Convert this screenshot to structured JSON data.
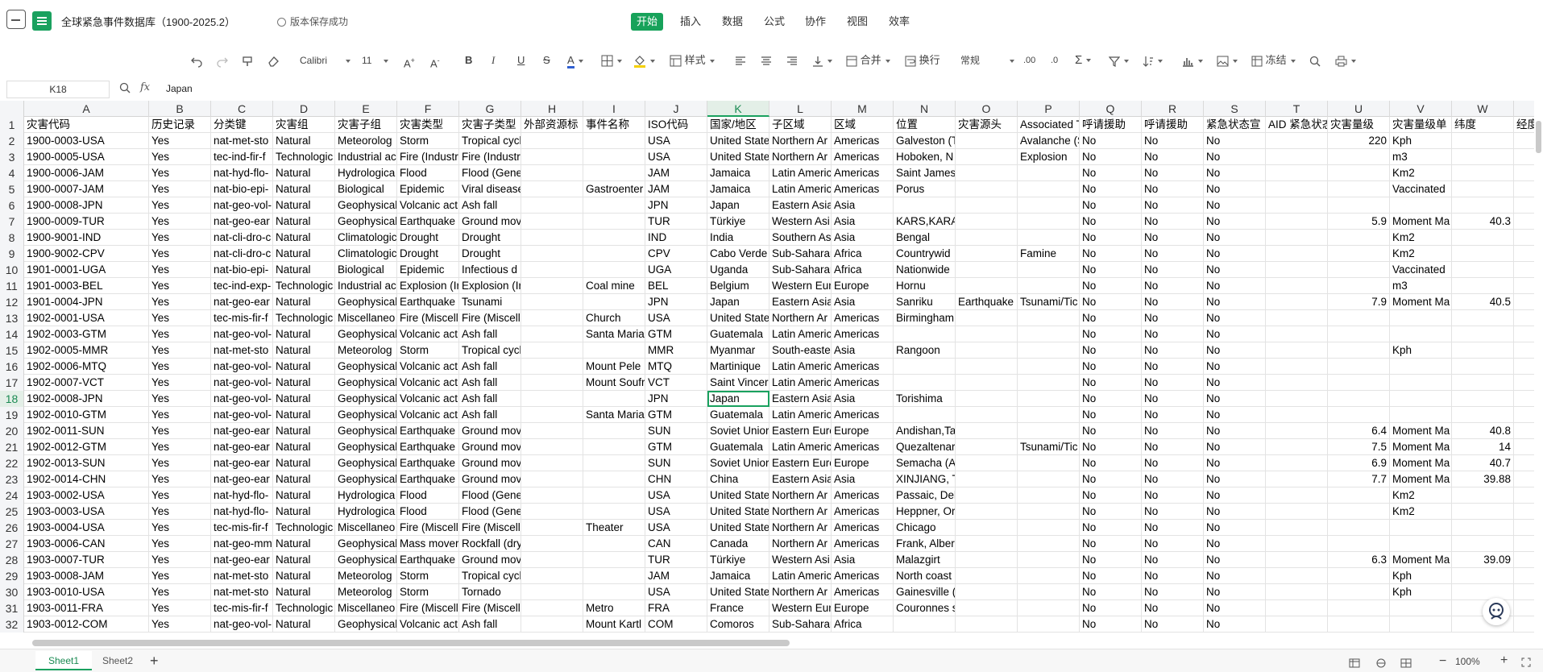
{
  "titlebar": {
    "doc_title": "全球紧急事件数据库（1900-2025.2）",
    "save_status": "版本保存成功",
    "menu_tabs": [
      "开始",
      "插入",
      "数据",
      "公式",
      "协作",
      "视图",
      "效率"
    ]
  },
  "toolbar": {
    "font_name": "Calibri",
    "font_size": "11",
    "style_label": "样式",
    "merge_label": "合并",
    "wrap_label": "换行",
    "format_label": "常规",
    "freeze_label": "冻结"
  },
  "formula_bar": {
    "cell_ref": "K18",
    "fx": "fx",
    "content": "Japan"
  },
  "grid": {
    "columns": [
      "A",
      "B",
      "C",
      "D",
      "E",
      "F",
      "G",
      "H",
      "I",
      "J",
      "K",
      "L",
      "M",
      "N",
      "O",
      "P",
      "Q",
      "R",
      "S",
      "T",
      "U",
      "V",
      "W",
      ""
    ],
    "header_row": [
      "灾害代码",
      "历史记录",
      "分类键",
      "灾害组",
      "灾害子组",
      "灾害类型",
      "灾害子类型",
      "外部资源标",
      "事件名称",
      "ISO代码",
      "国家/地区",
      "子区域",
      "区域",
      "位置",
      "灾害源头",
      "Associated T",
      "呼请援助",
      "呼请援助",
      "紧急状态宣",
      "AID 紧急状态",
      "灾害量级",
      "灾害量级单",
      "纬度",
      "经度"
    ],
    "rows": [
      {
        "n": "2",
        "cells": [
          "1900-0003-USA",
          "Yes",
          "nat-met-sto",
          "Natural",
          "Meteorolog",
          "Storm",
          "Tropical cycl",
          "",
          "",
          "USA",
          "United State",
          "Northern Ar",
          "Americas",
          "Galveston (T",
          "",
          "Avalanche (S",
          "No",
          "No",
          "No",
          "",
          "220",
          "Kph",
          "",
          ""
        ]
      },
      {
        "n": "3",
        "cells": [
          "1900-0005-USA",
          "Yes",
          "tec-ind-fir-f",
          "Technologic",
          "Industrial ac",
          "Fire (Industr",
          "Fire (Industr",
          "",
          "",
          "USA",
          "United State",
          "Northern Ar",
          "Americas",
          "Hoboken, N",
          "",
          "Explosion",
          "No",
          "No",
          "No",
          "",
          "",
          "m3",
          "",
          ""
        ]
      },
      {
        "n": "4",
        "cells": [
          "1900-0006-JAM",
          "Yes",
          "nat-hyd-flo-",
          "Natural",
          "Hydrologica",
          "Flood",
          "Flood (Gene",
          "",
          "",
          "JAM",
          "Jamaica",
          "Latin Americ",
          "Americas",
          "Saint James",
          "",
          "",
          "No",
          "No",
          "No",
          "",
          "",
          "Km2",
          "",
          ""
        ]
      },
      {
        "n": "5",
        "cells": [
          "1900-0007-JAM",
          "Yes",
          "nat-bio-epi-",
          "Natural",
          "Biological",
          "Epidemic",
          "Viral disease",
          "",
          "Gastroenter",
          "JAM",
          "Jamaica",
          "Latin Americ",
          "Americas",
          "Porus",
          "",
          "",
          "No",
          "No",
          "No",
          "",
          "",
          "Vaccinated",
          "",
          ""
        ]
      },
      {
        "n": "6",
        "cells": [
          "1900-0008-JPN",
          "Yes",
          "nat-geo-vol-",
          "Natural",
          "Geophysical",
          "Volcanic act",
          "Ash fall",
          "",
          "",
          "JPN",
          "Japan",
          "Eastern Asia",
          "Asia",
          "",
          "",
          "",
          "No",
          "No",
          "No",
          "",
          "",
          "",
          "",
          ""
        ]
      },
      {
        "n": "7",
        "cells": [
          "1900-0009-TUR",
          "Yes",
          "nat-geo-ear",
          "Natural",
          "Geophysical",
          "Earthquake",
          "Ground mov",
          "",
          "",
          "TUR",
          "Türkiye",
          "Western Asi",
          "Asia",
          "KARS,KARAK",
          "",
          "",
          "No",
          "No",
          "No",
          "",
          "5.9",
          "Moment Ma",
          "40.3",
          ""
        ]
      },
      {
        "n": "8",
        "cells": [
          "1900-9001-IND",
          "Yes",
          "nat-cli-dro-c",
          "Natural",
          "Climatologic",
          "Drought",
          "Drought",
          "",
          "",
          "IND",
          "India",
          "Southern As",
          "Asia",
          "Bengal",
          "",
          "",
          "No",
          "No",
          "No",
          "",
          "",
          "Km2",
          "",
          ""
        ]
      },
      {
        "n": "9",
        "cells": [
          "1900-9002-CPV",
          "Yes",
          "nat-cli-dro-c",
          "Natural",
          "Climatologic",
          "Drought",
          "Drought",
          "",
          "",
          "CPV",
          "Cabo Verde",
          "Sub-Saharar",
          "Africa",
          "Countrywid",
          "",
          "Famine",
          "No",
          "No",
          "No",
          "",
          "",
          "Km2",
          "",
          ""
        ]
      },
      {
        "n": "10",
        "cells": [
          "1901-0001-UGA",
          "Yes",
          "nat-bio-epi-",
          "Natural",
          "Biological",
          "Epidemic",
          "Infectious d",
          "",
          "",
          "UGA",
          "Uganda",
          "Sub-Saharar",
          "Africa",
          "Nationwide",
          "",
          "",
          "No",
          "No",
          "No",
          "",
          "",
          "Vaccinated",
          "",
          ""
        ]
      },
      {
        "n": "11",
        "cells": [
          "1901-0003-BEL",
          "Yes",
          "tec-ind-exp-",
          "Technologic",
          "Industrial ac",
          "Explosion (Ir",
          "Explosion (Ir",
          "",
          "Coal mine",
          "BEL",
          "Belgium",
          "Western Eur",
          "Europe",
          "Hornu",
          "",
          "",
          "No",
          "No",
          "No",
          "",
          "",
          "m3",
          "",
          ""
        ]
      },
      {
        "n": "12",
        "cells": [
          "1901-0004-JPN",
          "Yes",
          "nat-geo-ear",
          "Natural",
          "Geophysical",
          "Earthquake",
          "Tsunami",
          "",
          "",
          "JPN",
          "Japan",
          "Eastern Asia",
          "Asia",
          "Sanriku",
          "Earthquake",
          "Tsunami/Tic",
          "No",
          "No",
          "No",
          "",
          "7.9",
          "Moment Ma",
          "40.5",
          ""
        ]
      },
      {
        "n": "13",
        "cells": [
          "1902-0001-USA",
          "Yes",
          "tec-mis-fir-f",
          "Technologic",
          "Miscellaneo",
          "Fire (Miscell",
          "Fire (Miscell",
          "",
          "Church",
          "USA",
          "United State",
          "Northern Ar",
          "Americas",
          "Birmingham",
          "",
          "",
          "No",
          "No",
          "No",
          "",
          "",
          "",
          "",
          ""
        ]
      },
      {
        "n": "14",
        "cells": [
          "1902-0003-GTM",
          "Yes",
          "nat-geo-vol-",
          "Natural",
          "Geophysical",
          "Volcanic act",
          "Ash fall",
          "",
          "Santa Maria",
          "GTM",
          "Guatemala",
          "Latin Americ",
          "Americas",
          "",
          "",
          "",
          "No",
          "No",
          "No",
          "",
          "",
          "",
          "",
          ""
        ]
      },
      {
        "n": "15",
        "cells": [
          "1902-0005-MMR",
          "Yes",
          "nat-met-sto",
          "Natural",
          "Meteorolog",
          "Storm",
          "Tropical cycl",
          "",
          "",
          "MMR",
          "Myanmar",
          "South-easte",
          "Asia",
          "Rangoon",
          "",
          "",
          "No",
          "No",
          "No",
          "",
          "",
          "Kph",
          "",
          ""
        ]
      },
      {
        "n": "16",
        "cells": [
          "1902-0006-MTQ",
          "Yes",
          "nat-geo-vol-",
          "Natural",
          "Geophysical",
          "Volcanic act",
          "Ash fall",
          "",
          "Mount Pele",
          "MTQ",
          "Martinique",
          "Latin Americ",
          "Americas",
          "",
          "",
          "",
          "No",
          "No",
          "No",
          "",
          "",
          "",
          "",
          ""
        ]
      },
      {
        "n": "17",
        "cells": [
          "1902-0007-VCT",
          "Yes",
          "nat-geo-vol-",
          "Natural",
          "Geophysical",
          "Volcanic act",
          "Ash fall",
          "",
          "Mount Soufr",
          "VCT",
          "Saint Vincer",
          "Latin Americ",
          "Americas",
          "",
          "",
          "",
          "No",
          "No",
          "No",
          "",
          "",
          "",
          "",
          ""
        ]
      },
      {
        "n": "18",
        "cells": [
          "1902-0008-JPN",
          "Yes",
          "nat-geo-vol-",
          "Natural",
          "Geophysical",
          "Volcanic act",
          "Ash fall",
          "",
          "",
          "JPN",
          "Japan",
          "Eastern Asia",
          "Asia",
          "Torishima",
          "",
          "",
          "No",
          "No",
          "No",
          "",
          "",
          "",
          "",
          ""
        ]
      },
      {
        "n": "19",
        "cells": [
          "1902-0010-GTM",
          "Yes",
          "nat-geo-vol-",
          "Natural",
          "Geophysical",
          "Volcanic act",
          "Ash fall",
          "",
          "Santa Maria",
          "GTM",
          "Guatemala",
          "Latin Americ",
          "Americas",
          "",
          "",
          "",
          "No",
          "No",
          "No",
          "",
          "",
          "",
          "",
          ""
        ]
      },
      {
        "n": "20",
        "cells": [
          "1902-0011-SUN",
          "Yes",
          "nat-geo-ear",
          "Natural",
          "Geophysical",
          "Earthquake",
          "Ground mov",
          "",
          "",
          "SUN",
          "Soviet Unior",
          "Eastern Eurc",
          "Europe",
          "Andishan,Ta",
          "",
          "",
          "No",
          "No",
          "No",
          "",
          "6.4",
          "Moment Ma",
          "40.8",
          ""
        ]
      },
      {
        "n": "21",
        "cells": [
          "1902-0012-GTM",
          "Yes",
          "nat-geo-ear",
          "Natural",
          "Geophysical",
          "Earthquake",
          "Ground mov",
          "",
          "",
          "GTM",
          "Guatemala",
          "Latin Americ",
          "Americas",
          "Quezaltenar",
          "",
          "Tsunami/Tic",
          "No",
          "No",
          "No",
          "",
          "7.5",
          "Moment Ma",
          "14",
          ""
        ]
      },
      {
        "n": "22",
        "cells": [
          "1902-0013-SUN",
          "Yes",
          "nat-geo-ear",
          "Natural",
          "Geophysical",
          "Earthquake",
          "Ground mov",
          "",
          "",
          "SUN",
          "Soviet Unior",
          "Eastern Eurc",
          "Europe",
          "Semacha (Az",
          "",
          "",
          "No",
          "No",
          "No",
          "",
          "6.9",
          "Moment Ma",
          "40.7",
          ""
        ]
      },
      {
        "n": "23",
        "cells": [
          "1902-0014-CHN",
          "Yes",
          "nat-geo-ear",
          "Natural",
          "Geophysical",
          "Earthquake",
          "Ground mov",
          "",
          "",
          "CHN",
          "China",
          "Eastern Asia",
          "Asia",
          "XINJIANG, T",
          "",
          "",
          "No",
          "No",
          "No",
          "",
          "7.7",
          "Moment Ma",
          "39.88",
          ""
        ]
      },
      {
        "n": "24",
        "cells": [
          "1903-0002-USA",
          "Yes",
          "nat-hyd-flo-",
          "Natural",
          "Hydrologica",
          "Flood",
          "Flood (Gene",
          "",
          "",
          "USA",
          "United State",
          "Northern Ar",
          "Americas",
          "Passaic, Dela",
          "",
          "",
          "No",
          "No",
          "No",
          "",
          "",
          "Km2",
          "",
          ""
        ]
      },
      {
        "n": "25",
        "cells": [
          "1903-0003-USA",
          "Yes",
          "nat-hyd-flo-",
          "Natural",
          "Hydrologica",
          "Flood",
          "Flood (Gene",
          "",
          "",
          "USA",
          "United State",
          "Northern Ar",
          "Americas",
          "Heppner, Or",
          "",
          "",
          "No",
          "No",
          "No",
          "",
          "",
          "Km2",
          "",
          ""
        ]
      },
      {
        "n": "26",
        "cells": [
          "1903-0004-USA",
          "Yes",
          "tec-mis-fir-f",
          "Technologic",
          "Miscellaneo",
          "Fire (Miscell",
          "Fire (Miscell",
          "",
          "Theater",
          "USA",
          "United State",
          "Northern Ar",
          "Americas",
          "Chicago",
          "",
          "",
          "No",
          "No",
          "No",
          "",
          "",
          "",
          "",
          ""
        ]
      },
      {
        "n": "27",
        "cells": [
          "1903-0006-CAN",
          "Yes",
          "nat-geo-mm",
          "Natural",
          "Geophysical",
          "Mass mover",
          "Rockfall (dry",
          "",
          "",
          "CAN",
          "Canada",
          "Northern Ar",
          "Americas",
          "Frank, Alber",
          "",
          "",
          "No",
          "No",
          "No",
          "",
          "",
          "",
          "",
          ""
        ]
      },
      {
        "n": "28",
        "cells": [
          "1903-0007-TUR",
          "Yes",
          "nat-geo-ear",
          "Natural",
          "Geophysical",
          "Earthquake",
          "Ground mov",
          "",
          "",
          "TUR",
          "Türkiye",
          "Western Asi",
          "Asia",
          "Malazgirt",
          "",
          "",
          "No",
          "No",
          "No",
          "",
          "6.3",
          "Moment Ma",
          "39.09",
          ""
        ]
      },
      {
        "n": "29",
        "cells": [
          "1903-0008-JAM",
          "Yes",
          "nat-met-sto",
          "Natural",
          "Meteorolog",
          "Storm",
          "Tropical cycl",
          "",
          "",
          "JAM",
          "Jamaica",
          "Latin Americ",
          "Americas",
          "North coast",
          "",
          "",
          "No",
          "No",
          "No",
          "",
          "",
          "Kph",
          "",
          ""
        ]
      },
      {
        "n": "30",
        "cells": [
          "1903-0010-USA",
          "Yes",
          "nat-met-sto",
          "Natural",
          "Meteorolog",
          "Storm",
          "Tornado",
          "",
          "",
          "USA",
          "United State",
          "Northern Ar",
          "Americas",
          "Gainesville (",
          "",
          "",
          "No",
          "No",
          "No",
          "",
          "",
          "Kph",
          "",
          ""
        ]
      },
      {
        "n": "31",
        "cells": [
          "1903-0011-FRA",
          "Yes",
          "tec-mis-fir-f",
          "Technologic",
          "Miscellaneo",
          "Fire (Miscell",
          "Fire (Miscell",
          "",
          "Metro",
          "FRA",
          "France",
          "Western Eur",
          "Europe",
          "Couronnes s",
          "",
          "",
          "No",
          "No",
          "No",
          "",
          "",
          "",
          "",
          ""
        ]
      },
      {
        "n": "32",
        "cells": [
          "1903-0012-COM",
          "Yes",
          "nat-geo-vol-",
          "Natural",
          "Geophysical",
          "Volcanic act",
          "Ash fall",
          "",
          "Mount Kartl",
          "COM",
          "Comoros",
          "Sub-Saharar",
          "Africa",
          "",
          "",
          "",
          "No",
          "No",
          "No",
          "",
          "",
          "",
          "",
          ""
        ]
      }
    ]
  },
  "sheets": {
    "tabs": [
      "Sheet1",
      "Sheet2"
    ],
    "active": "Sheet1",
    "add": "+"
  },
  "status": {
    "zoom": "100%"
  }
}
